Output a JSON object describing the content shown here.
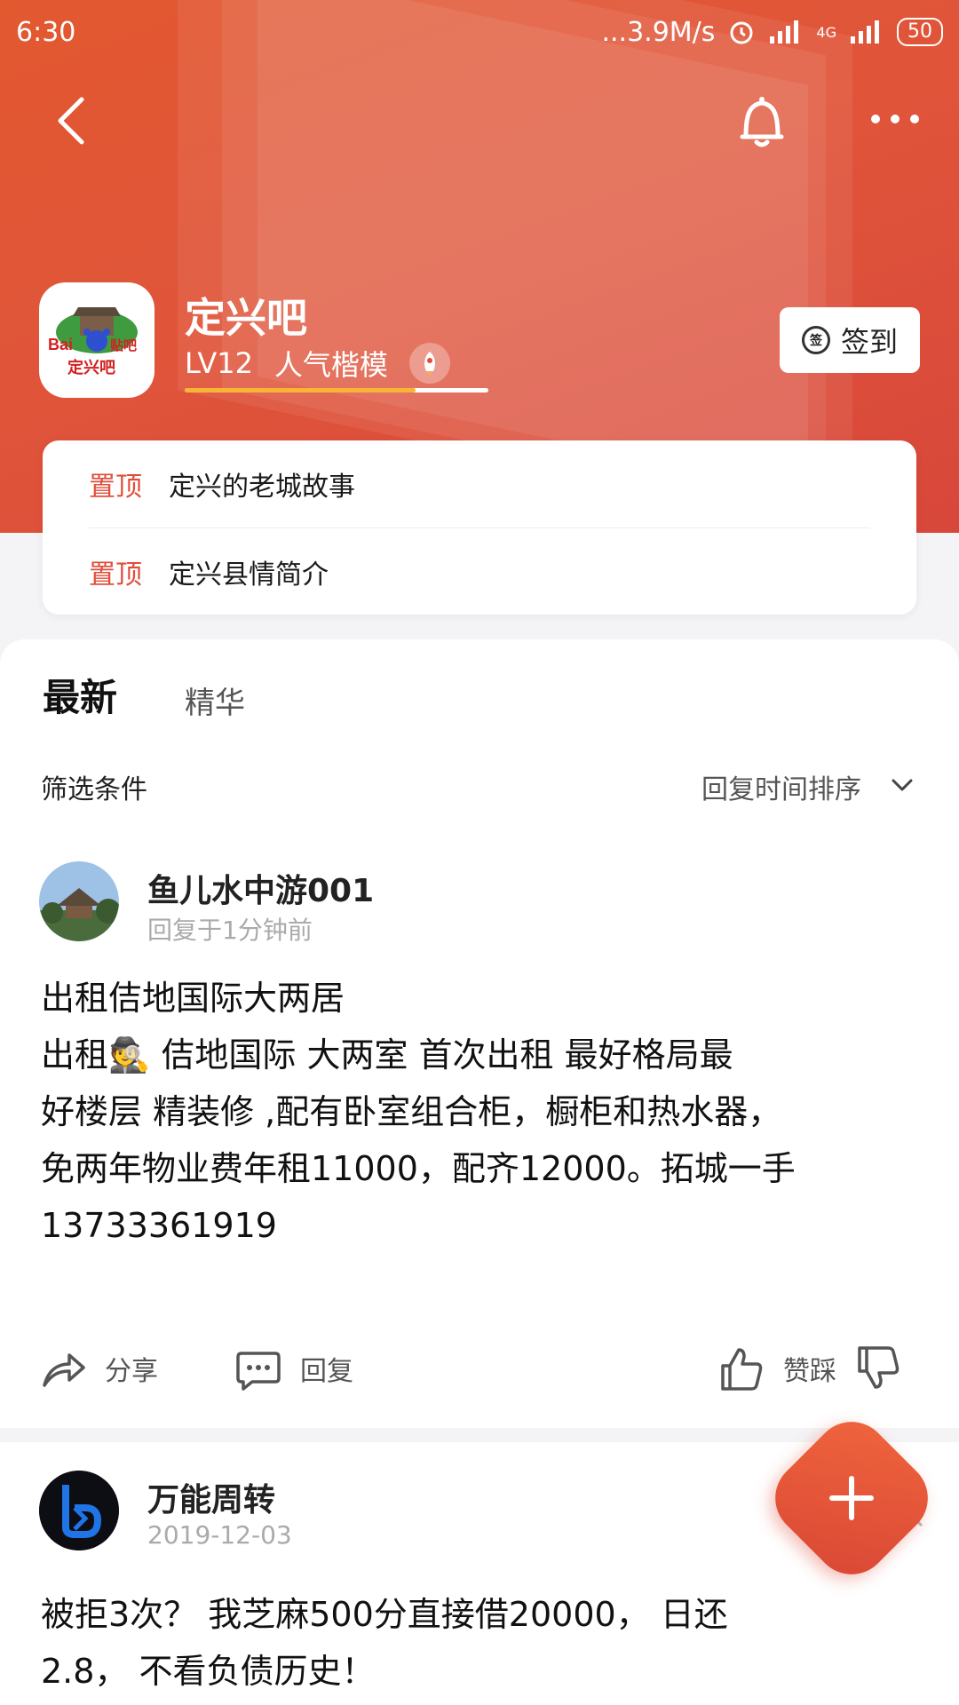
{
  "status_bar": {
    "time": "6:30",
    "network_speed": "...3.9M/s",
    "network_type": "4G",
    "battery": "50"
  },
  "forum": {
    "name": "定兴吧",
    "level": "LV12",
    "title": "人气楷模",
    "progress": 0.76
  },
  "signin": {
    "label": "签到",
    "icon_text": "签"
  },
  "pinned": [
    {
      "tag": "置顶",
      "title": "定兴的老城故事"
    },
    {
      "tag": "置顶",
      "title": "定兴县情简介"
    }
  ],
  "tabs": [
    {
      "label": "最新"
    },
    {
      "label": "精华"
    }
  ],
  "filter": {
    "label": "筛选条件",
    "sort": "回复时间排序"
  },
  "posts": [
    {
      "author": "鱼儿水中游001",
      "time": "回复于1分钟前",
      "title": "出租佶地国际大两居",
      "body_line1": "出租🕵️ 佶地国际 大两室 首次出租 最好格局最",
      "body_line2": "好楼层 精装修 ,配有卧室组合柜，橱柜和热水器，",
      "body_line3": "免两年物业费年租11000，配齐12000。拓城一手",
      "body_line4": "13733361919",
      "share": "分享",
      "reply": "回复",
      "vote": "赞踩"
    },
    {
      "author": "万能周转",
      "time": "2019-12-03",
      "body_line1": "被拒3次？ 我芝麻500分直接借20000， 日还",
      "body_line2": "2.8， 不看负债历史！"
    }
  ],
  "colors": {
    "header": "#e2582f",
    "accent": "#e04d3a",
    "level_bar": "#f7b436"
  }
}
